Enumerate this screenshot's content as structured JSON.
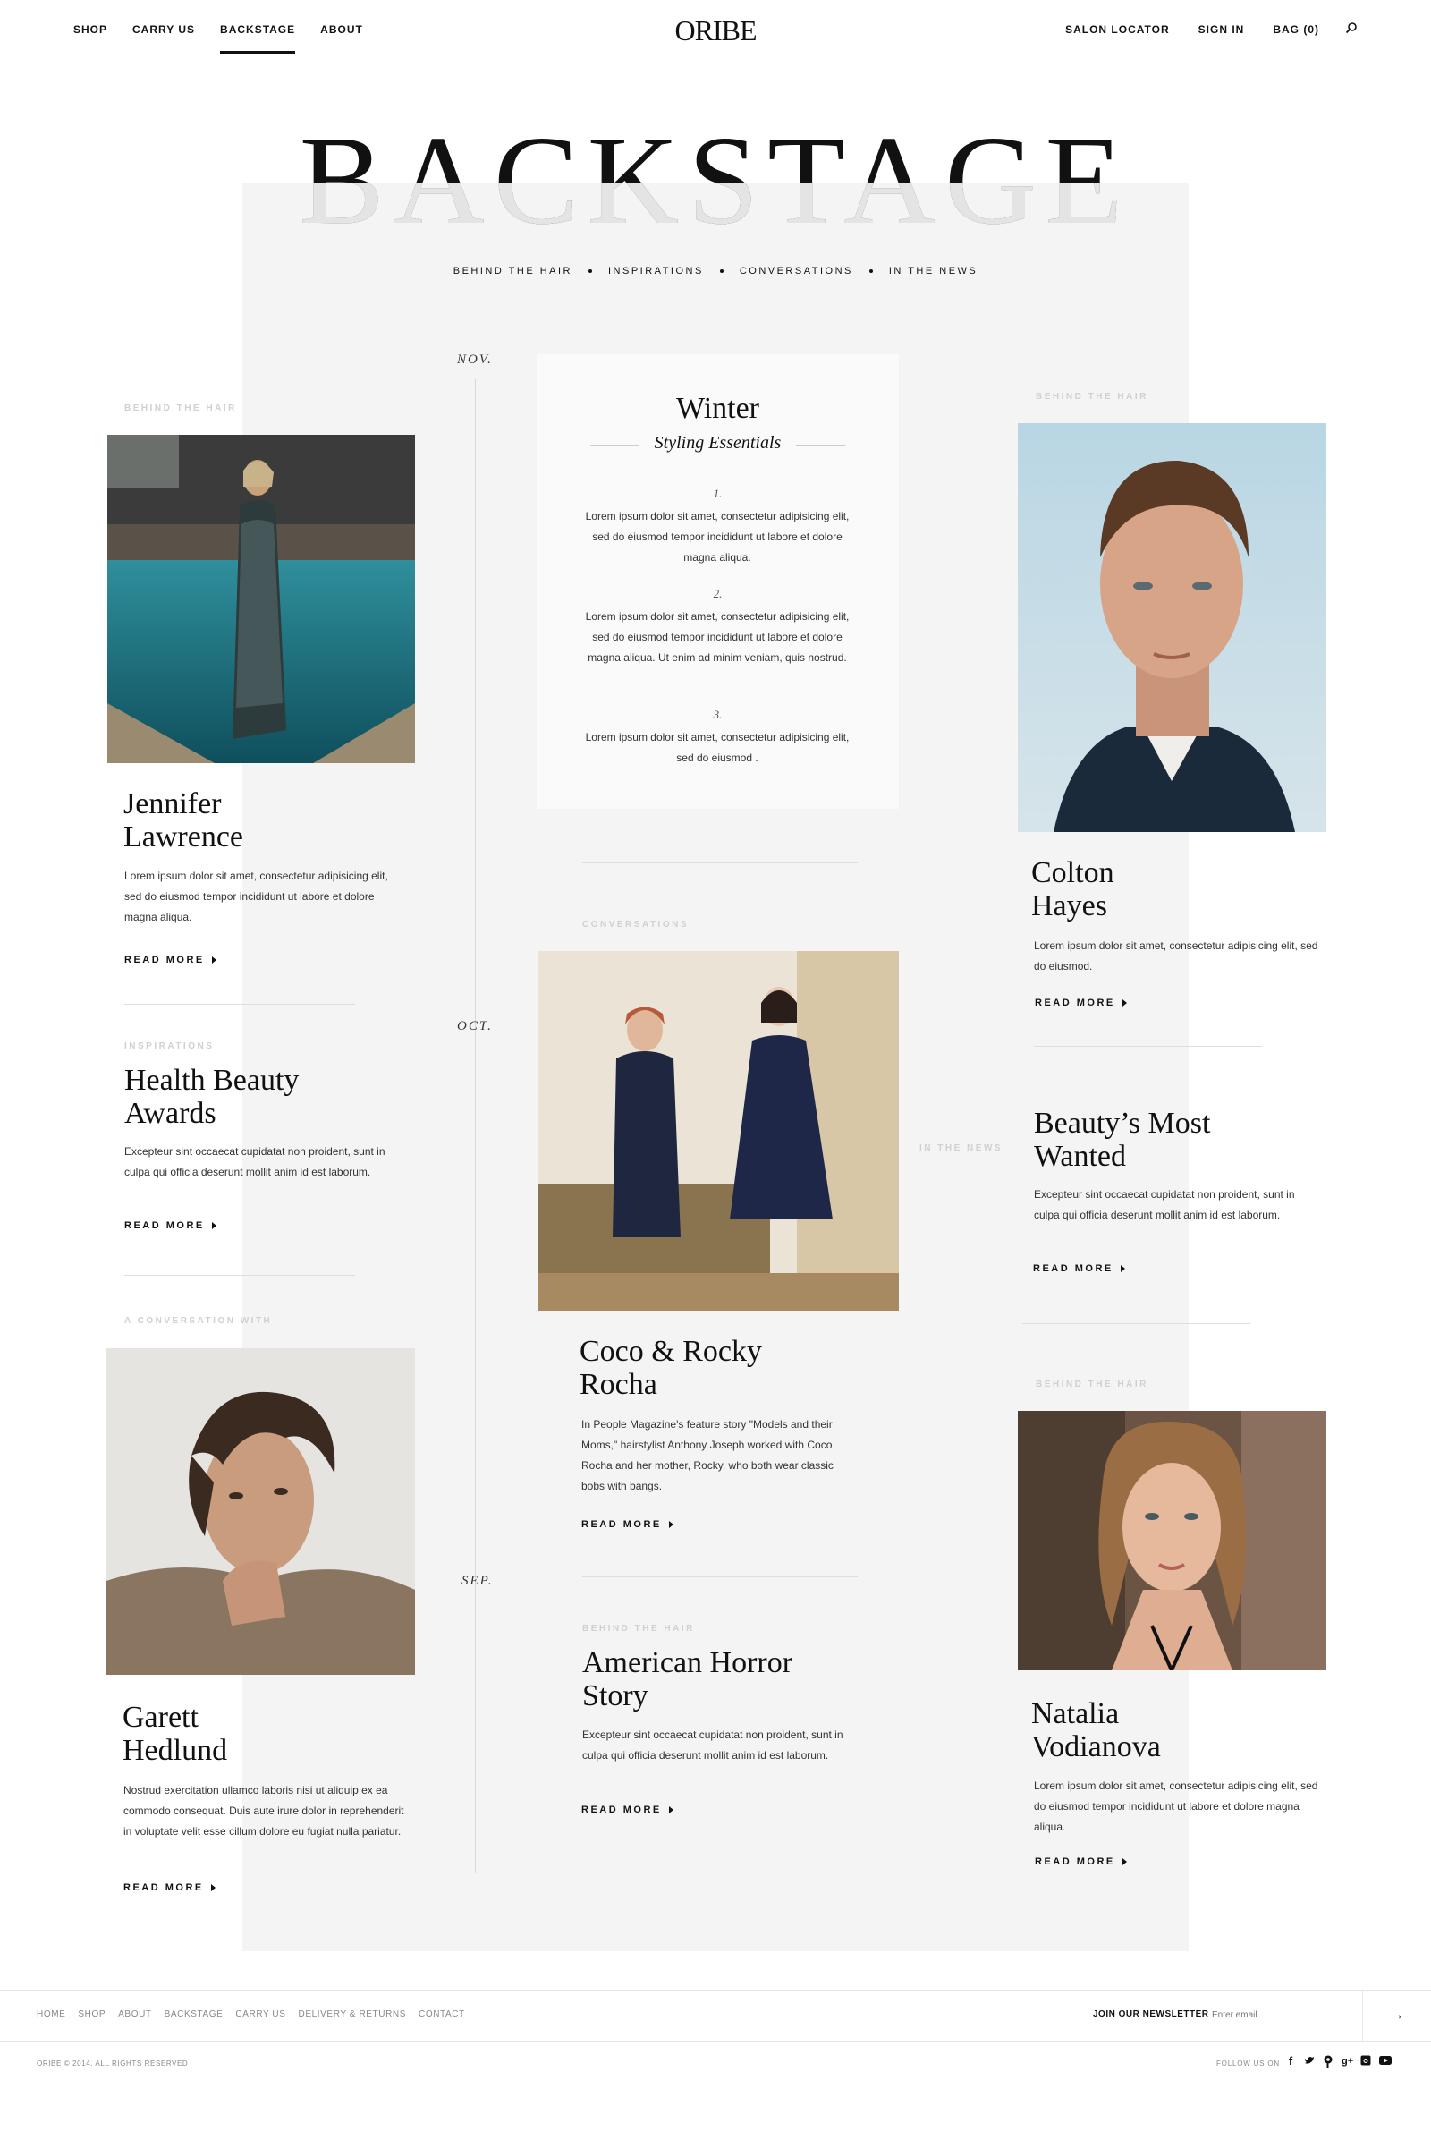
{
  "header": {
    "nav_left": [
      "SHOP",
      "CARRY US",
      "BACKSTAGE",
      "ABOUT"
    ],
    "logo": "ORIBE",
    "nav_right": [
      "SALON LOCATOR",
      "SIGN IN",
      "BAG (0)"
    ],
    "active": "BACKSTAGE"
  },
  "hero": {
    "title": "BACKSTAGE",
    "subnav": [
      "BEHIND THE HAIR",
      "INSPIRATIONS",
      "CONVERSATIONS",
      "IN THE NEWS"
    ]
  },
  "timeline": {
    "months": [
      "NOV.",
      "OCT.",
      "SEP."
    ]
  },
  "feature": {
    "title": "Winter",
    "subtitle": "Styling Essentials",
    "points": [
      {
        "num": "1.",
        "text": "Lorem ipsum dolor sit amet, consectetur adipisicing elit, sed do eiusmod tempor incididunt ut labore et dolore magna aliqua."
      },
      {
        "num": "2.",
        "text": "Lorem ipsum dolor sit amet, consectetur adipisicing elit, sed do eiusmod tempor incididunt ut labore et dolore magna aliqua. Ut enim ad minim veniam, quis nostrud."
      },
      {
        "num": "3.",
        "text": "Lorem ipsum dolor sit amet, consectetur adipisicing elit, sed do eiusmod ."
      }
    ]
  },
  "cards": {
    "jennifer": {
      "category": "BEHIND THE HAIR",
      "title": "Jennifer\nLawrence",
      "body": "Lorem ipsum dolor sit amet, consectetur adipisicing elit, sed do eiusmod tempor incididunt ut labore et dolore magna aliqua.",
      "cta": "READ MORE"
    },
    "health": {
      "category": "INSPIRATIONS",
      "title": "Health Beauty\nAwards",
      "body": "Excepteur sint occaecat cupidatat non proident, sunt in culpa qui officia deserunt mollit anim id est laborum.",
      "cta": "READ MORE"
    },
    "garett": {
      "category": "A CONVERSATION WITH",
      "title": "Garett\nHedlund",
      "body": "Nostrud exercitation ullamco laboris nisi ut aliquip ex ea commodo consequat. Duis aute irure dolor in reprehenderit in voluptate velit esse cillum dolore eu fugiat nulla pariatur.",
      "cta": "READ MORE"
    },
    "coco": {
      "category": "CONVERSATIONS",
      "title": "Coco & Rocky\nRocha",
      "body": "In People Magazine's feature story \"Models and their Moms,\" hairstylist Anthony Joseph worked with Coco Rocha and her mother, Rocky, who both wear classic bobs with bangs.",
      "cta": "READ MORE"
    },
    "horror": {
      "category": "BEHIND THE HAIR",
      "title": "American Horror\nStory",
      "body": "Excepteur sint occaecat cupidatat non proident, sunt in culpa qui officia deserunt mollit anim id est laborum.",
      "cta": "READ MORE"
    },
    "colton": {
      "category": "BEHIND THE HAIR",
      "title": "Colton\nHayes",
      "body": "Lorem ipsum dolor sit amet, consectetur adipisicing elit, sed do eiusmod.",
      "cta": "READ MORE"
    },
    "wanted": {
      "category": "IN THE NEWS",
      "title": "Beauty’s Most\nWanted",
      "body": "Excepteur sint occaecat cupidatat non proident, sunt in culpa qui officia deserunt mollit anim id est laborum.",
      "cta": "READ MORE"
    },
    "natalia": {
      "category": "BEHIND THE HAIR",
      "title": "Natalia\nVodianova",
      "body": "Lorem ipsum dolor sit amet, consectetur adipisicing elit, sed do eiusmod tempor incididunt ut labore et dolore magna aliqua.",
      "cta": "READ MORE"
    }
  },
  "footer": {
    "links": [
      "HOME",
      "SHOP",
      "ABOUT",
      "BACKSTAGE",
      "CARRY US",
      "DELIVERY & RETURNS",
      "CONTACT"
    ],
    "newsletter_label": "JOIN OUR NEWSLETTER",
    "newsletter_placeholder": "Enter email",
    "submit": "→",
    "copyright": "ORIBE © 2014. ALL RIGHTS RESERVED",
    "follow": "FOLLOW US ON",
    "socials": [
      "facebook-icon",
      "twitter-icon",
      "pinterest-icon",
      "google-plus-icon",
      "instagram-icon",
      "youtube-icon"
    ]
  }
}
